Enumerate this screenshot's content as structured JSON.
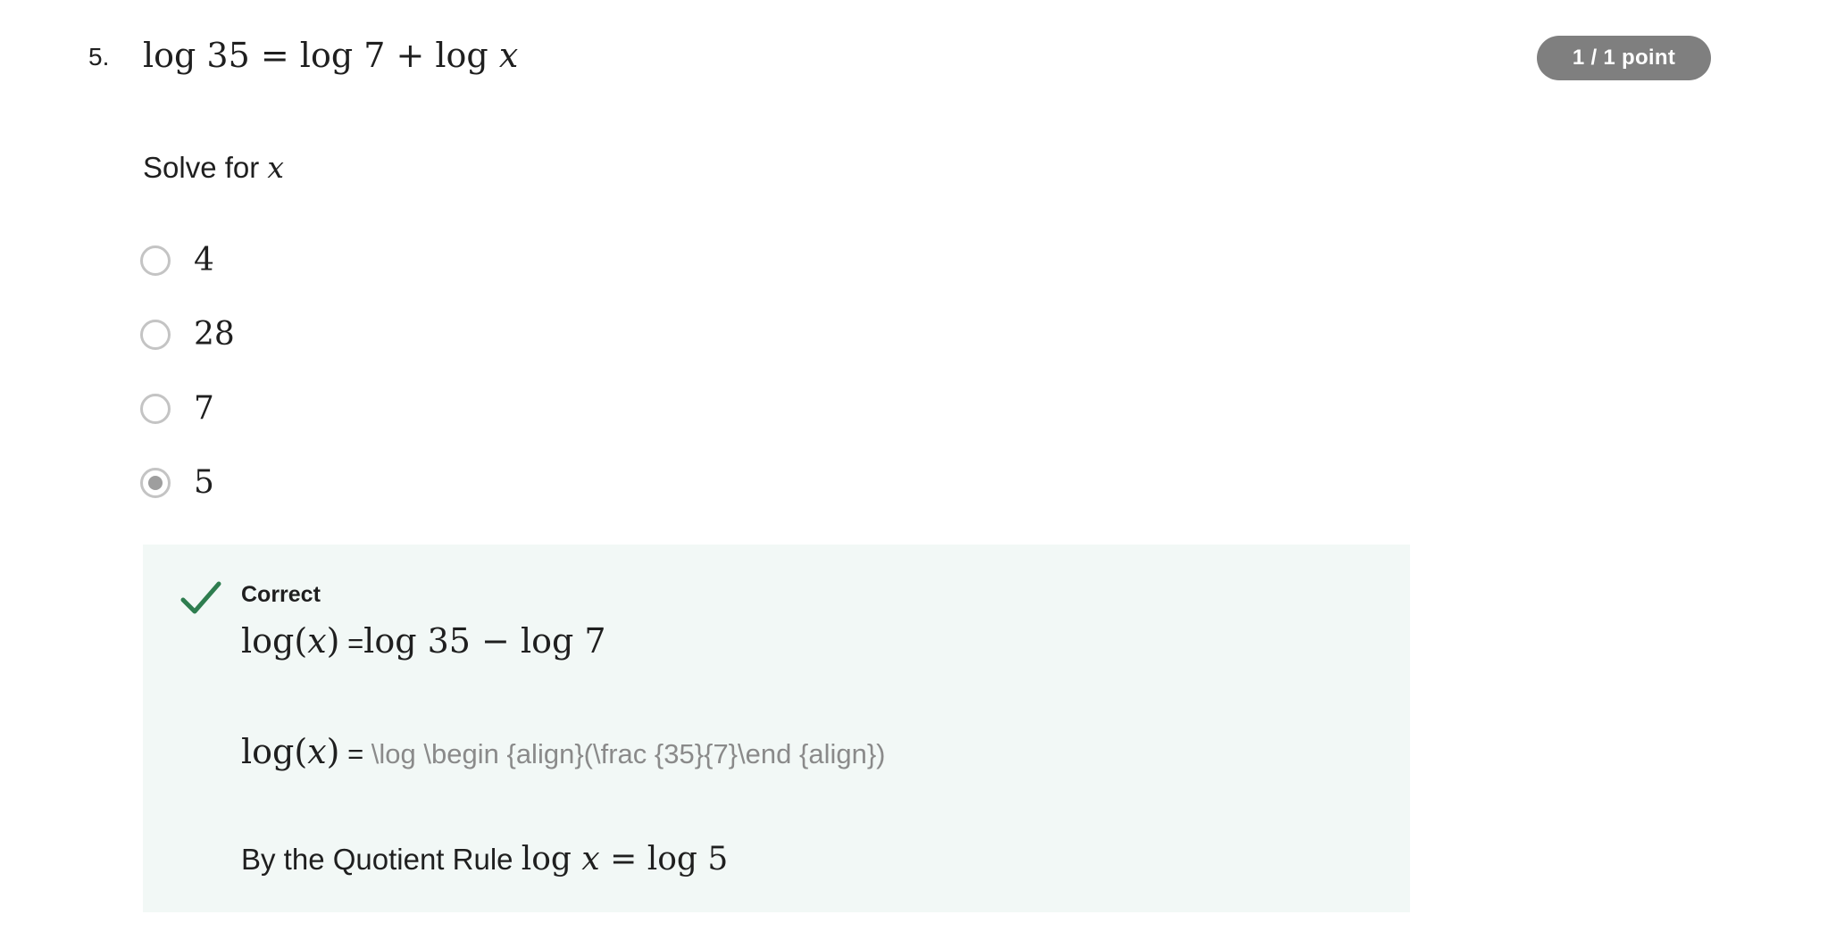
{
  "question": {
    "number": "5.",
    "title_parts": [
      "log 35 = log 7 + log ",
      "x"
    ],
    "points": "1 / 1 point",
    "prompt_text": "Solve for ",
    "prompt_var": "x"
  },
  "options": [
    {
      "label": "4",
      "selected": false
    },
    {
      "label": "28",
      "selected": false
    },
    {
      "label": "7",
      "selected": false
    },
    {
      "label": "5",
      "selected": true
    }
  ],
  "feedback": {
    "status": "Correct",
    "line1": {
      "lhs_fn": "log(",
      "lhs_var": "x",
      "lhs_close": ")",
      "eq": " =",
      "rhs": "log 35 − log 7"
    },
    "line2": {
      "lhs_fn": "log(",
      "lhs_var": "x",
      "lhs_close": ")",
      "eq": " = ",
      "raw": "\\log \\begin {align}(\\frac {35}{7}\\end {align})"
    },
    "line3": {
      "text": "By the Quotient Rule ",
      "fn": "log ",
      "var": "x",
      "rhs": " = log 5"
    }
  },
  "colors": {
    "badge_bg": "#7f7f7f",
    "feedback_bg": "#f2f8f6",
    "check_green": "#2e7d4f",
    "radio_border": "#c4c4c4",
    "raw_latex_text": "#8a8a8a"
  },
  "icons": {
    "status_icon": "check-icon"
  }
}
